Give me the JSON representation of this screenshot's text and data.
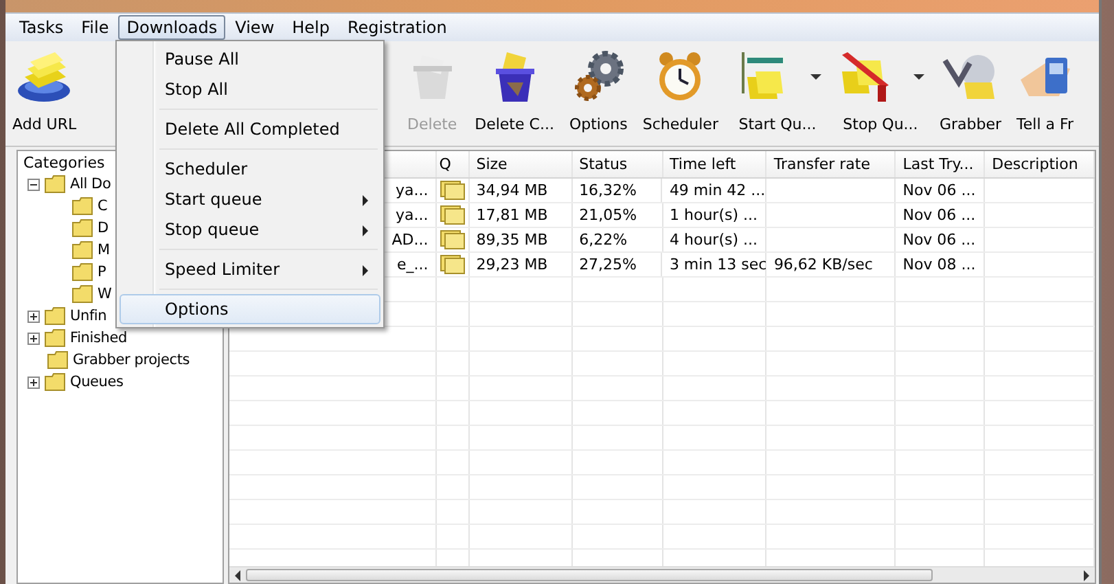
{
  "menubar": [
    {
      "label": "Tasks",
      "selected": false
    },
    {
      "label": "File",
      "selected": false
    },
    {
      "label": "Downloads",
      "selected": true
    },
    {
      "label": "View",
      "selected": false
    },
    {
      "label": "Help",
      "selected": false
    },
    {
      "label": "Registration",
      "selected": false
    }
  ],
  "toolbar": [
    {
      "label": "Add URL",
      "kind": "add",
      "disabled": false
    },
    {
      "label": "Delete",
      "kind": "trash",
      "disabled": true
    },
    {
      "label": "Delete C...",
      "kind": "bin",
      "disabled": false
    },
    {
      "label": "Options",
      "kind": "gears",
      "disabled": false
    },
    {
      "label": "Scheduler",
      "kind": "clock",
      "disabled": false
    },
    {
      "label": "Start Qu...",
      "kind": "start",
      "disabled": false,
      "dropdown": true
    },
    {
      "label": "Stop Qu...",
      "kind": "stop",
      "disabled": false,
      "dropdown": true
    },
    {
      "label": "Grabber",
      "kind": "grabber",
      "disabled": false
    },
    {
      "label": "Tell a Fr",
      "kind": "hand",
      "disabled": false
    }
  ],
  "sidebar": {
    "title": "Categories",
    "tree": [
      {
        "label": "All Do",
        "expanded": true,
        "children": [
          {
            "label": "C"
          },
          {
            "label": "D"
          },
          {
            "label": "M"
          },
          {
            "label": "P"
          },
          {
            "label": "W"
          }
        ]
      },
      {
        "label": "Unfin",
        "expanded": false
      },
      {
        "label": "Finished",
        "expanded": false
      },
      {
        "label": "Grabber projects"
      },
      {
        "label": "Queues",
        "expanded": false
      }
    ]
  },
  "table": {
    "columns": [
      "Q",
      "Size",
      "Status",
      "Time left",
      "Transfer rate",
      "Last Try...",
      "Description"
    ],
    "rows": [
      {
        "name": "ya...",
        "size": "34,94  MB",
        "status": "16,32%",
        "time_left": "49 min 42 ...",
        "rate": "",
        "last_try": "Nov 06 ..."
      },
      {
        "name": "ya...",
        "size": "17,81  MB",
        "status": "21,05%",
        "time_left": "1 hour(s) ...",
        "rate": "",
        "last_try": "Nov 06 ..."
      },
      {
        "name": "AD...",
        "size": "89,35  MB",
        "status": "6,22%",
        "time_left": "4 hour(s) ...",
        "rate": "",
        "last_try": "Nov 06 ..."
      },
      {
        "name": "e_...",
        "size": "29,23  MB",
        "status": "27,25%",
        "time_left": "3 min 13 sec",
        "rate": "96,62  KB/sec",
        "last_try": "Nov 08 ..."
      }
    ]
  },
  "menu": [
    {
      "kind": "item",
      "label": "Pause All",
      "selected": false
    },
    {
      "kind": "item",
      "label": "Stop All",
      "selected": false
    },
    {
      "kind": "separator"
    },
    {
      "kind": "item",
      "label": "Delete All Completed",
      "selected": false
    },
    {
      "kind": "separator"
    },
    {
      "kind": "item",
      "label": "Scheduler",
      "selected": false
    },
    {
      "kind": "item",
      "label": "Start queue",
      "selected": false,
      "submenu": true
    },
    {
      "kind": "item",
      "label": "Stop queue",
      "selected": false,
      "submenu": true
    },
    {
      "kind": "separator"
    },
    {
      "kind": "item",
      "label": "Speed Limiter",
      "selected": false,
      "submenu": true
    },
    {
      "kind": "separator"
    },
    {
      "kind": "item",
      "label": "Options",
      "selected": true
    }
  ]
}
